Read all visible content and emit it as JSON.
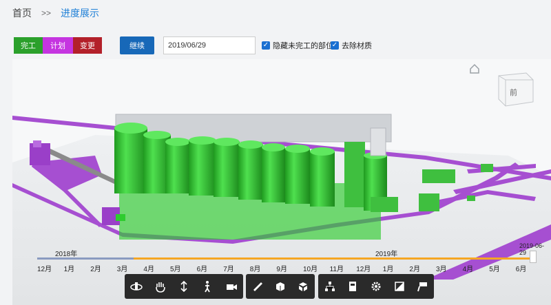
{
  "breadcrumb": {
    "home": "首页",
    "separator": ">>",
    "current": "进度展示"
  },
  "filters": {
    "done_label": "完工",
    "plan_label": "计划",
    "change_label": "变更"
  },
  "continue_label": "继续",
  "date_value": "2019/06/29",
  "checkboxes": [
    {
      "label": "隐藏未完工的部位",
      "checked": true
    },
    {
      "label": "去除材质",
      "checked": true
    }
  ],
  "viewcube": {
    "face_label": "前"
  },
  "timeline": {
    "year_left": "2018年",
    "year_right": "2019年",
    "current": "2019-06-29",
    "months": [
      "12月",
      "1月",
      "2月",
      "3月",
      "4月",
      "5月",
      "6月",
      "7月",
      "8月",
      "9月",
      "10月",
      "11月",
      "12月",
      "1月",
      "2月",
      "3月",
      "4月",
      "5月",
      "6月"
    ],
    "progress_color": "#f5a623",
    "past_color": "#8a9bc0"
  },
  "colors": {
    "complete": "#2ecc2e",
    "conveyor": "#a64fd1",
    "plan": "#c535e0"
  },
  "toolbar": {
    "group1": [
      "orbit-icon",
      "pan-hand-icon",
      "vertical-move-icon",
      "walk-person-icon",
      "camera-icon"
    ],
    "group2": [
      "measure-ruler-icon",
      "section-box-icon",
      "explode-icon"
    ],
    "group3": [
      "structure-tree-icon",
      "properties-icon",
      "settings-gear-icon",
      "fullscreen-icon",
      "comment-icon"
    ]
  }
}
